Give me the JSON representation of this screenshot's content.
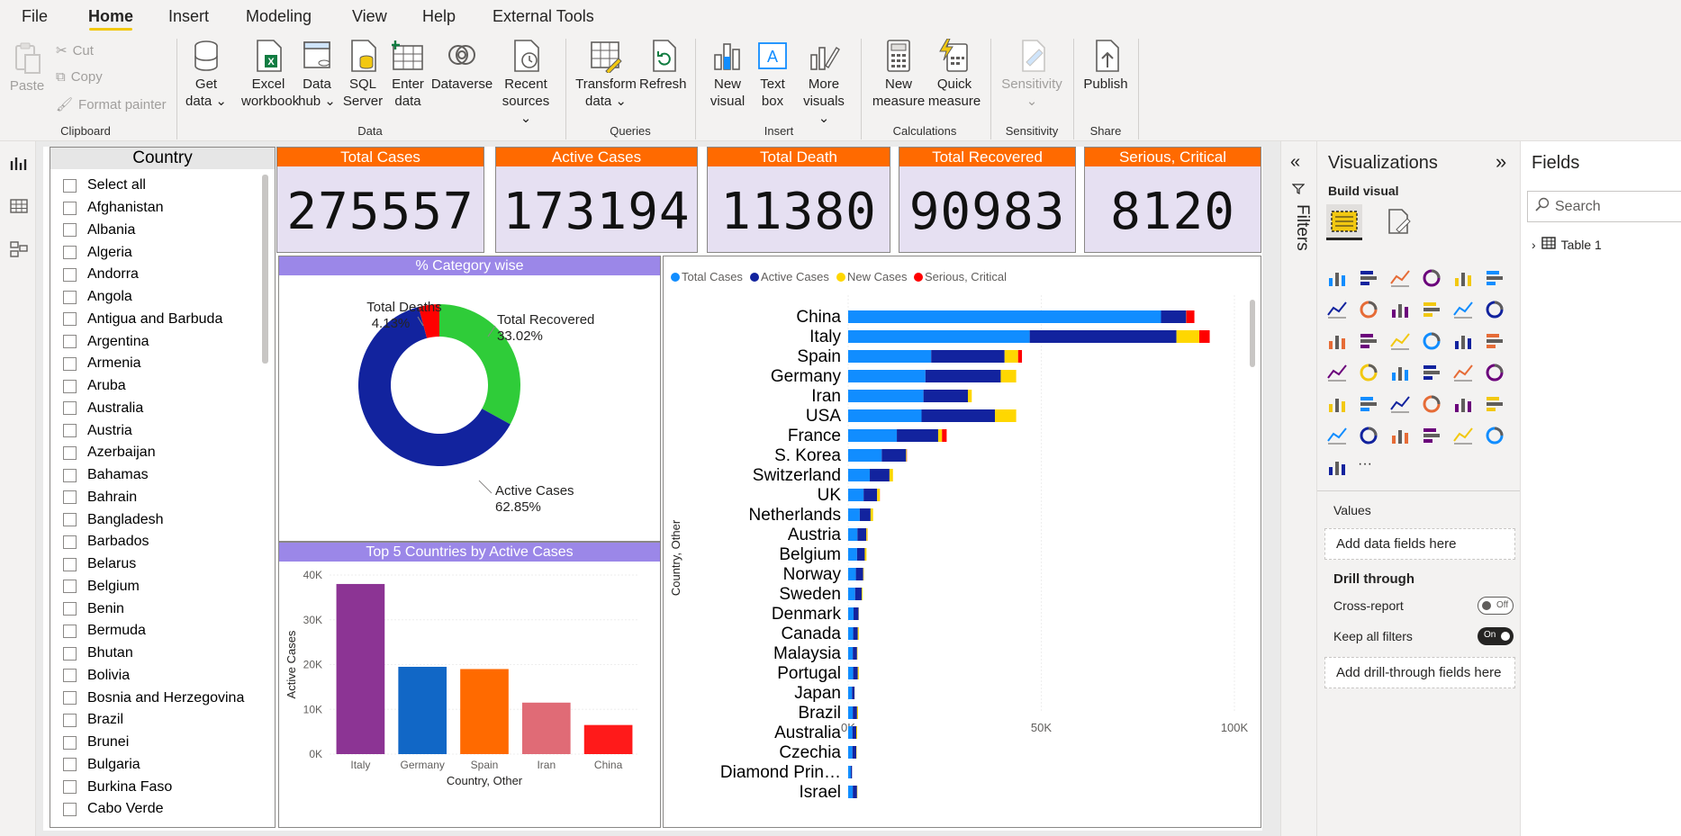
{
  "menu": {
    "items": [
      "File",
      "Home",
      "Insert",
      "Modeling",
      "View",
      "Help",
      "External Tools"
    ],
    "active": "Home"
  },
  "ribbon": {
    "clipboard": {
      "paste": "Paste",
      "cut": "Cut",
      "copy": "Copy",
      "format_painter": "Format painter",
      "group": "Clipboard"
    },
    "data": {
      "get_data": [
        "Get",
        "data ⌄"
      ],
      "excel": [
        "Excel",
        "workbook"
      ],
      "data_hub": [
        "Data",
        "hub ⌄"
      ],
      "sql": [
        "SQL",
        "Server"
      ],
      "enter": [
        "Enter",
        "data"
      ],
      "dataverse": [
        "Dataverse"
      ],
      "recent": [
        "Recent",
        "sources ⌄"
      ],
      "group": "Data"
    },
    "queries": {
      "transform": [
        "Transform",
        "data ⌄"
      ],
      "refresh": [
        "Refresh"
      ],
      "group": "Queries"
    },
    "insert": {
      "new_visual": [
        "New",
        "visual"
      ],
      "text_box": [
        "Text",
        "box"
      ],
      "more": [
        "More",
        "visuals ⌄"
      ],
      "group": "Insert"
    },
    "calculations": {
      "new_measure": [
        "New",
        "measure"
      ],
      "quick_measure": [
        "Quick",
        "measure"
      ],
      "group": "Calculations"
    },
    "sensitivity": {
      "label": [
        "Sensitivity",
        "⌄"
      ],
      "group": "Sensitivity"
    },
    "share": {
      "publish": [
        "Publish"
      ],
      "group": "Share"
    }
  },
  "slicer": {
    "title": "Country",
    "items": [
      "Select all",
      "Afghanistan",
      "Albania",
      "Algeria",
      "Andorra",
      "Angola",
      "Antigua and Barbuda",
      "Argentina",
      "Armenia",
      "Aruba",
      "Australia",
      "Austria",
      "Azerbaijan",
      "Bahamas",
      "Bahrain",
      "Bangladesh",
      "Barbados",
      "Belarus",
      "Belgium",
      "Benin",
      "Bermuda",
      "Bhutan",
      "Bolivia",
      "Bosnia and Herzegovina",
      "Brazil",
      "Brunei",
      "Bulgaria",
      "Burkina Faso",
      "Cabo Verde"
    ]
  },
  "cards": [
    {
      "title": "Total Cases",
      "value": "275557"
    },
    {
      "title": "Active Cases",
      "value": "173194"
    },
    {
      "title": "Total Death",
      "value": "11380"
    },
    {
      "title": "Total Recovered",
      "value": "90983"
    },
    {
      "title": "Serious, Critical",
      "value": "8120"
    }
  ],
  "colors": {
    "total_cases": "#118dff",
    "active_cases": "#12239e",
    "new_cases": "#ffd700",
    "serious": "#ff0000",
    "recovered": "#2fcc39",
    "card_header": "#ff6a00",
    "panel_header": "#9b87e8"
  },
  "chart_data": [
    {
      "type": "pie",
      "title": "% Category wise",
      "slices": [
        {
          "label": "Total Recovered",
          "pct_label": "33.02%",
          "value": 33.02,
          "color": "#2fcc39"
        },
        {
          "label": "Active Cases",
          "pct_label": "62.85%",
          "value": 62.85,
          "color": "#12239e"
        },
        {
          "label": "Total Deaths",
          "pct_label": "4.13%",
          "value": 4.13,
          "color": "#ff0000"
        }
      ]
    },
    {
      "type": "bar",
      "title": "Top 5 Countries by Active Cases",
      "xlabel": "Country, Other",
      "ylabel": "Active Cases",
      "categories": [
        "Italy",
        "Germany",
        "Spain",
        "Iran",
        "China"
      ],
      "values": [
        38000,
        19500,
        19000,
        11500,
        6500
      ],
      "colors": [
        "#8c3494",
        "#1167c6",
        "#ff6a00",
        "#e06b76",
        "#ff1a1a"
      ],
      "ylim": [
        0,
        40000
      ],
      "yticks": [
        "0K",
        "10K",
        "20K",
        "30K",
        "40K"
      ]
    },
    {
      "type": "bar",
      "orientation": "horizontal",
      "stacked": true,
      "xlabel": "",
      "ylabel": "Country, Other",
      "legend": [
        "Total Cases",
        "Active Cases",
        "New Cases",
        "Serious, Critical"
      ],
      "legend_position": "top-left",
      "xlim": [
        0,
        100000
      ],
      "xticks": [
        "0K",
        "50K",
        "100K"
      ],
      "categories": [
        "China",
        "Italy",
        "Spain",
        "Germany",
        "Iran",
        "USA",
        "France",
        "S. Korea",
        "Switzerland",
        "UK",
        "Netherlands",
        "Austria",
        "Belgium",
        "Norway",
        "Sweden",
        "Denmark",
        "Canada",
        "Malaysia",
        "Portugal",
        "Japan",
        "Brazil",
        "Australia",
        "Czechia",
        "Diamond Prin…",
        "Israel"
      ],
      "series": [
        {
          "name": "Total Cases",
          "values": [
            81000,
            47000,
            21500,
            20000,
            19500,
            19000,
            12600,
            8700,
            5600,
            4000,
            3000,
            2400,
            2300,
            2000,
            1800,
            1400,
            1300,
            1200,
            1300,
            1000,
            1200,
            1100,
            1100,
            700,
            1200
          ]
        },
        {
          "name": "Active Cases",
          "values": [
            6500,
            38000,
            19000,
            19500,
            11500,
            19000,
            10700,
            6300,
            5100,
            3500,
            2800,
            2300,
            2000,
            1900,
            1700,
            1300,
            1200,
            1100,
            1200,
            650,
            1100,
            1000,
            1000,
            300,
            1100
          ]
        },
        {
          "name": "New Cases",
          "values": [
            40,
            5900,
            3500,
            4000,
            1000,
            5500,
            1000,
            150,
            900,
            700,
            650,
            300,
            450,
            150,
            200,
            60,
            250,
            130,
            250,
            30,
            250,
            230,
            100,
            0,
            100
          ]
        },
        {
          "name": "Serious, Critical",
          "values": [
            2100,
            2700,
            1000,
            0,
            0,
            0,
            1200,
            60,
            0,
            20,
            0,
            30,
            0,
            0,
            0,
            0,
            0,
            0,
            0,
            0,
            0,
            0,
            0,
            0,
            0
          ]
        }
      ]
    }
  ],
  "filters": {
    "label": "Filters"
  },
  "visualizations": {
    "title": "Visualizations",
    "build_visual": "Build visual",
    "values_label": "Values",
    "values_placeholder": "Add data fields here",
    "drill_through": "Drill through",
    "cross_report": "Cross-report",
    "cross_report_state": "Off",
    "keep_filters": "Keep all filters",
    "keep_filters_state": "On",
    "drill_placeholder": "Add drill-through fields here"
  },
  "fields": {
    "title": "Fields",
    "search_placeholder": "Search",
    "tables": [
      "Table 1"
    ]
  }
}
